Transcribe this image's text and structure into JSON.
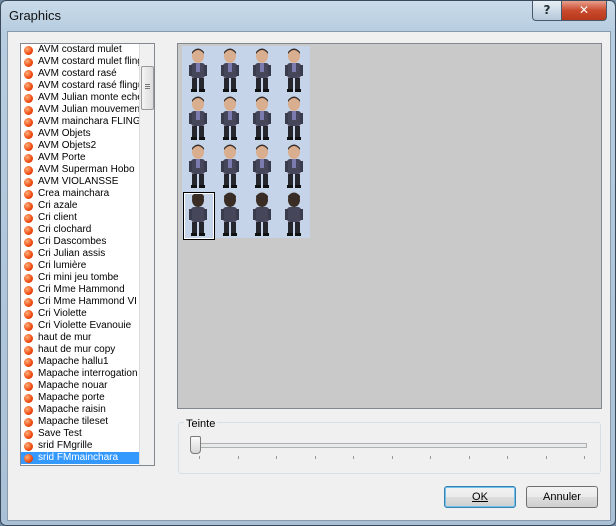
{
  "window": {
    "title": "Graphics"
  },
  "titlebar": {
    "help_label": "?",
    "close_label": "✕"
  },
  "graphics_list": {
    "items": [
      "AVM  costard  mulet",
      "AVM  costard  mulet  flingue",
      "AVM  costard  rasé",
      "AVM  costard  rasé  flingue",
      "AVM  Julian  monte  echelle",
      "AVM  Julian  mouvement",
      "AVM  mainchara  FLINGUE",
      "AVM  Objets",
      "AVM  Objets2",
      "AVM  Porte",
      "AVM  Superman  Hobo",
      "AVM  VIOLANSSE",
      "Crea  mainchara",
      "Cri  azale",
      "Cri  client",
      "Cri  clochard",
      "Cri  Dascombes",
      "Cri  Julian  assis",
      "Cri  lumière",
      "Cri  mini  jeu  tombe",
      "Cri  Mme  Hammond",
      "Cri  Mme  Hammond  VI",
      "Cri  Violette",
      "Cri  Violette  Evanouie",
      "haut de mur",
      "haut de mur copy",
      "Mapache hallu1",
      "Mapache interrogation",
      "Mapache nouar",
      "Mapache porte",
      "Mapache raisin",
      "Mapache tileset",
      "Save Test",
      "srid  FMgrille",
      "srid  FMmainchara"
    ],
    "selected_index": 34
  },
  "tint": {
    "label": "Teinte",
    "value": 0
  },
  "buttons": {
    "ok_label": "OK",
    "cancel_label": "Annuler"
  },
  "colors": {
    "selection": "#3399ff",
    "sheet_bg": "#c6d4ea",
    "preview_bg": "#c9c9c9"
  }
}
